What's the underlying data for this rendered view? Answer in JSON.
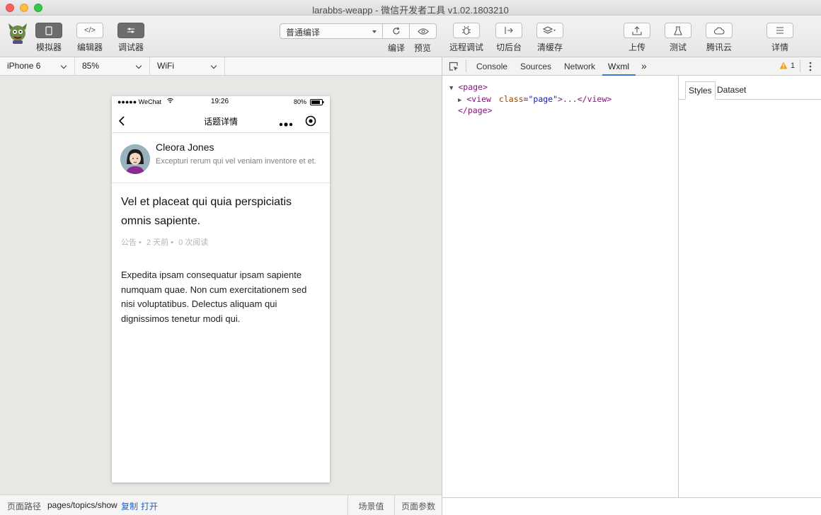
{
  "window": {
    "title": "larabbs-weapp - 微信开发者工具 v1.02.1803210"
  },
  "toolbar": {
    "simulator_label": "模拟器",
    "editor_label": "编辑器",
    "debugger_label": "调试器",
    "compile_mode": "普通编译",
    "compile_label": "编译",
    "preview_label": "预览",
    "remote_debug_label": "远程调试",
    "background_label": "切后台",
    "clear_cache_label": "清缓存",
    "upload_label": "上传",
    "test_label": "测试",
    "tencent_cloud_label": "腾讯云",
    "details_label": "详情",
    "editor_glyph": "</>"
  },
  "devicebar": {
    "device": "iPhone 6",
    "zoom": "85%",
    "network": "WiFi"
  },
  "phone": {
    "status": {
      "carrier": "●●●●● WeChat",
      "time": "19:26",
      "battery": "80%"
    },
    "nav_title": "话题详情",
    "author": {
      "name": "Cleora Jones",
      "intro": "Excepturi rerum qui vel veniam inventore et et."
    },
    "topic": {
      "title": "Vel et placeat qui quia perspiciatis omnis sapiente.",
      "category": "公告",
      "time": "2 天前",
      "views": "0 次阅读",
      "body": "Expedita ipsam consequatur ipsam sapiente numquam quae. Non cum exercitationem sed nisi voluptatibus. Delectus aliquam qui dignissimos tenetur modi qui."
    }
  },
  "bottombar": {
    "path_label": "页面路径",
    "path": "pages/topics/show",
    "copy": "复制",
    "open": "打开",
    "scene_label": "场景值",
    "params_label": "页面参数"
  },
  "devtools": {
    "tabs": [
      "Console",
      "Sources",
      "Network",
      "Wxml"
    ],
    "more": "»",
    "warning_count": "1",
    "wxml": {
      "page_open": "<page>",
      "view_open": "<view",
      "attr_name": "class",
      "attr_value": "\"page\"",
      "view_close": ">...</view>",
      "page_close": "</page>"
    },
    "side_tabs": [
      "Styles",
      "Dataset"
    ]
  },
  "colors": {
    "accent": "#3879d9",
    "link": "#1d64c8",
    "warning": "#f0a020"
  }
}
